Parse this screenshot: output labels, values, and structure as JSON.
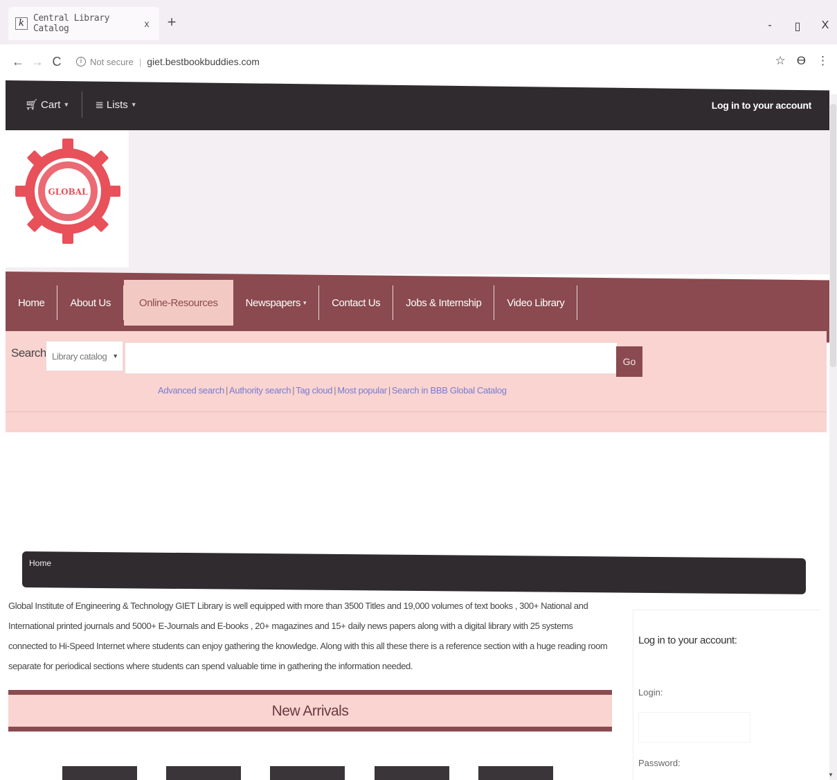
{
  "browser": {
    "tab_title": "Central Library Catalog",
    "tab_favicon": "k",
    "tab_close": "x",
    "new_tab": "+",
    "window_controls": {
      "minimize": "-",
      "restore": "▯",
      "close": "X"
    },
    "security_label": "Not secure",
    "url": "giet.bestbookbuddies.com",
    "icons": [
      "back-arrow-icon",
      "forward-arrow-icon",
      "reload-icon",
      "info-icon",
      "star-icon",
      "profile-icon",
      "menu-dots-icon"
    ]
  },
  "topbar": {
    "cart_label": "Cart",
    "lists_label": "Lists",
    "login_link": "Log in to your account"
  },
  "logo": {
    "text": "GLOBAL",
    "color": "#e8505a"
  },
  "mainnav": {
    "items": [
      {
        "label": "Home"
      },
      {
        "label": "About Us"
      },
      {
        "label": "Online-Resources"
      },
      {
        "label": "Newspapers"
      },
      {
        "label": "Contact Us"
      },
      {
        "label": "Jobs & Internship"
      },
      {
        "label": "Video Library"
      }
    ],
    "active_index": 2
  },
  "search": {
    "label": "Search",
    "select_value": "Library catalog",
    "input_value": "",
    "go_label": "Go",
    "links": [
      "Advanced search",
      "Authority search",
      "Tag cloud",
      "Most popular",
      "Search in BBB Global Catalog"
    ],
    "separator": "|"
  },
  "breadcrumb": {
    "label": "Home"
  },
  "intro": {
    "text": "Global Institute of Engineering & Technology GIET Library is well equipped with more than 3500 Titles and 19,000 volumes of text books , 300+ National and International printed journals and 5000+ E-Journals and E-books , 20+ magazines and 15+ daily news papers along with a digital library with 25 systems connected to Hi-Speed Internet where students can enjoy gathering the knowledge. Along with this all these there is a reference section with a huge reading room separate for periodical sections where students can spend valuable time in gathering the information needed."
  },
  "new_arrivals": {
    "title": "New Arrivals"
  },
  "login_panel": {
    "title": "Log in to your account:",
    "login_label": "Login:",
    "login_value": "",
    "password_label": "Password:"
  },
  "colors": {
    "dark_bar": "#2f2b2e",
    "nav_bg": "#8a4a4f",
    "search_band": "#f9d4d1",
    "active_tab": "#f3c9c4",
    "link": "#7a7ad0"
  }
}
